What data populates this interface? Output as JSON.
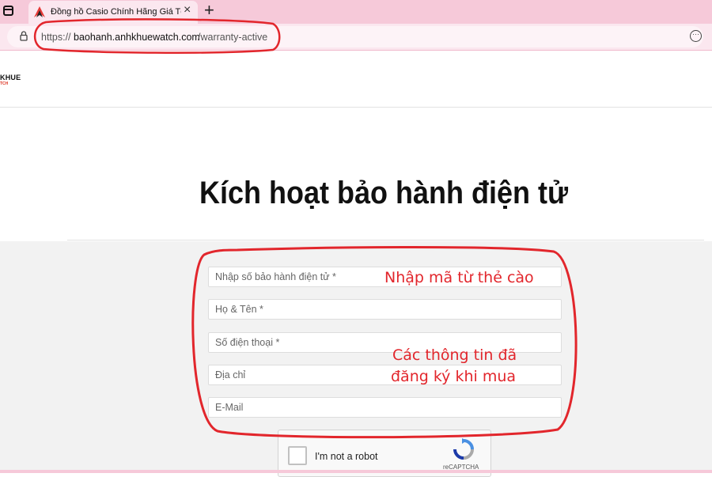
{
  "browser": {
    "tab_title": "Đồng hồ Casio Chính Hãng Giá Tố",
    "close_glyph": "×",
    "new_tab_glyph": "+",
    "url_protocol": "https://",
    "url_host": "baohanh.anhkhuewatch.com",
    "url_path": "/warranty-active",
    "menu_glyph": "···"
  },
  "header": {
    "logo_text": "KHUE",
    "logo_sub": "TCH"
  },
  "page": {
    "title": "Kích hoạt bảo hành điện tử"
  },
  "form": {
    "fields": [
      {
        "placeholder": "Nhập số bảo hành điện tử *"
      },
      {
        "placeholder": "Họ & Tên *"
      },
      {
        "placeholder": "Số điện thoại *"
      },
      {
        "placeholder": "Địa chỉ"
      },
      {
        "placeholder": "E-Mail"
      }
    ]
  },
  "annotations": {
    "code_hint": "Nhập mã từ thẻ cào",
    "info_hint_line1": "Các thông tin đã",
    "info_hint_line2": "đăng ký khi mua"
  },
  "recaptcha": {
    "label": "I'm not a robot",
    "brand": "reCAPTCHA"
  },
  "colors": {
    "annotation_red": "#e2262c",
    "tab_pink": "#f6c9d9"
  }
}
